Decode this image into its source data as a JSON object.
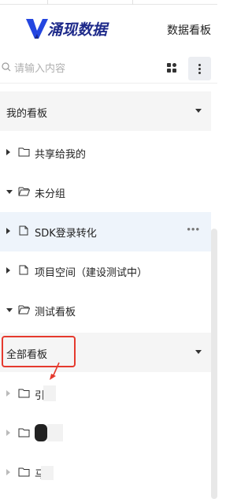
{
  "header": {
    "logo_text": "涌现数据",
    "logo_letter": "V",
    "title": "数据看板"
  },
  "search": {
    "placeholder": "请输入内容",
    "value": ""
  },
  "toolbar": {
    "grid_icon": "grid-icon",
    "more_icon": "more-vertical-icon"
  },
  "groups": [
    {
      "label": "我的看板",
      "expanded": true
    },
    {
      "label": "全部看板",
      "expanded": true
    }
  ],
  "my_items": [
    {
      "label": "共享给我的",
      "expanded": false
    },
    {
      "label": "未分组",
      "expanded": true
    },
    {
      "label": "SDK登录转化",
      "expanded": false,
      "selected": true,
      "more": "•••"
    },
    {
      "label": "项目空间（建设测试中）",
      "expanded": false
    },
    {
      "label": "测试看板",
      "expanded": true
    }
  ],
  "all_items": [
    {
      "label": "引"
    },
    {
      "label": ""
    },
    {
      "label": "马"
    }
  ],
  "colors": {
    "accent": "#1e2a8a",
    "selected_bg": "#eef4fb",
    "annotation": "#e53a2e"
  }
}
